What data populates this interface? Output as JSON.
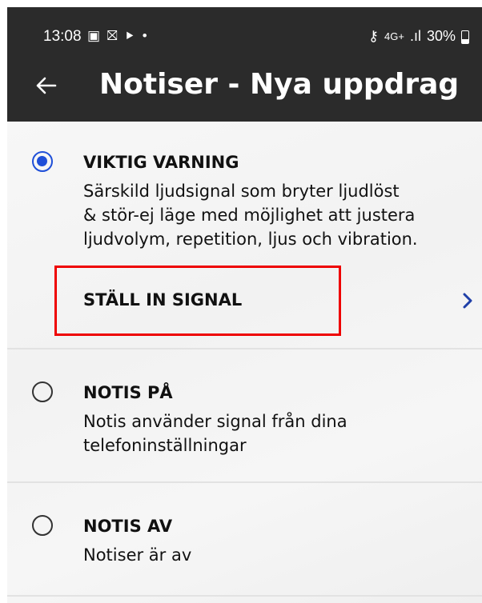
{
  "status_bar": {
    "time": "13:08",
    "left_icons": "▣ ⛝ ⯈ •",
    "key_icon": "⚷",
    "network": "4G+",
    "signal": ".ıl",
    "battery": "30%"
  },
  "header": {
    "back_icon": "arrow-left-icon",
    "title": "Notiser - Nya uppdrag"
  },
  "options": [
    {
      "title": "VIKTIG VARNING",
      "description": "Särskild ljudsignal som bryter ljudlöst\n& stör-ej läge med möjlighet att justera\nljudvolym, repetition, ljus och vibration.",
      "selected": true
    },
    {
      "title": "NOTIS PÅ",
      "description": "Notis använder signal från dina\ntelefoninställningar",
      "selected": false
    },
    {
      "title": "NOTIS AV",
      "description": "Notiser är av",
      "selected": false
    }
  ],
  "signal_setting": {
    "label": "STÄLL IN SIGNAL",
    "chevron_icon": "chevron-right-icon"
  },
  "colors": {
    "header_bg": "#2b2b2b",
    "accent": "#1f4fd8",
    "highlight": "#ee0000"
  }
}
